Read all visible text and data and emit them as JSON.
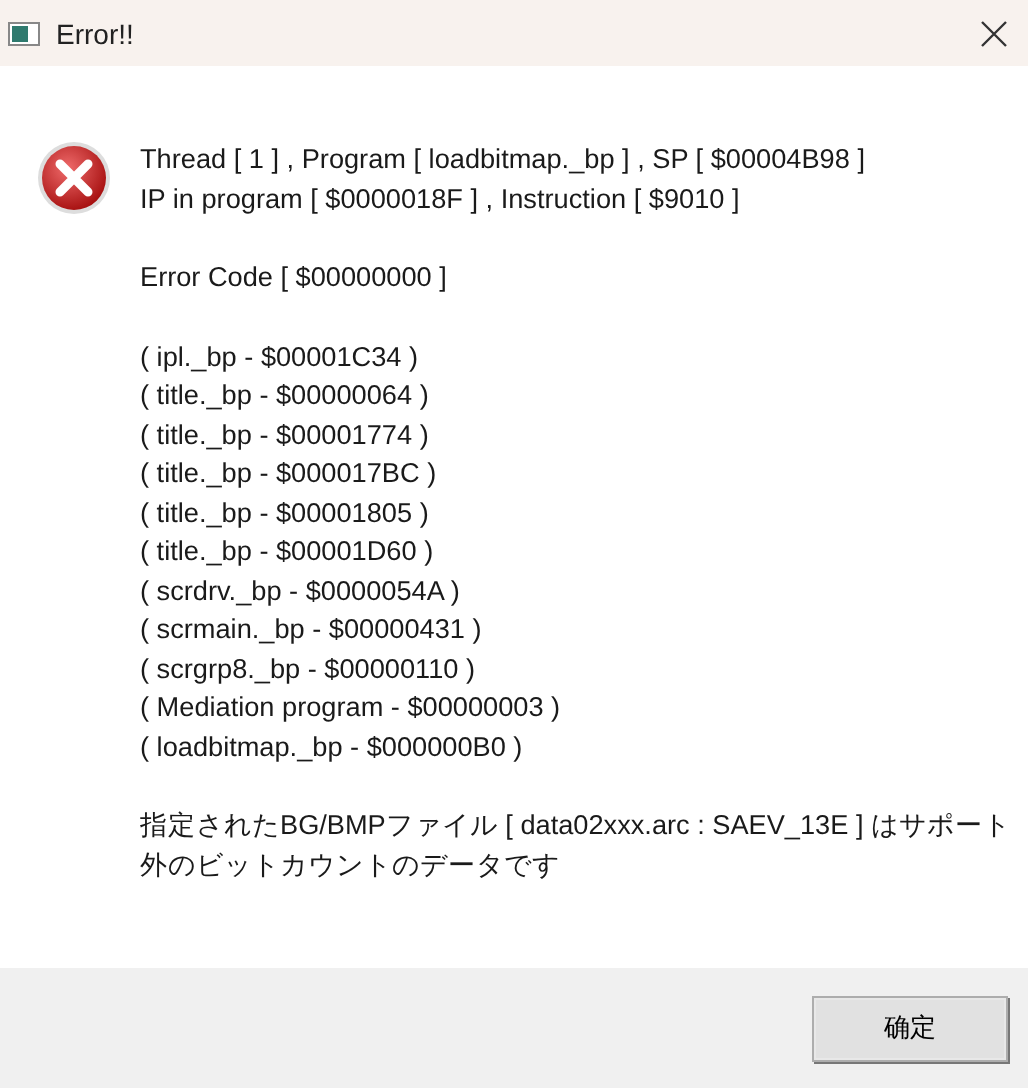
{
  "window": {
    "title": "Error!!"
  },
  "message": {
    "paragraphs": [
      [
        "Thread [ 1 ] , Program [ loadbitmap._bp ] , SP [ $00004B98 ]",
        "IP in program [ $0000018F ] , Instruction [ $9010 ]"
      ],
      [
        "Error Code [ $00000000 ]"
      ],
      [
        "( ipl._bp - $00001C34 )",
        "( title._bp - $00000064 )",
        "( title._bp - $00001774 )",
        "( title._bp - $000017BC )",
        "( title._bp - $00001805 )",
        "( title._bp - $00001D60 )",
        "( scrdrv._bp - $0000054A )",
        "( scrmain._bp - $00000431 )",
        "( scrgrp8._bp - $00000110 )",
        "( Mediation program - $00000003 )",
        "( loadbitmap._bp - $000000B0 )"
      ],
      [
        "指定されたBG/BMPファイル [ data02xxx.arc : SAEV_13E ] はサポート外のビットカウントのデータです"
      ]
    ]
  },
  "buttons": [
    "确定"
  ]
}
